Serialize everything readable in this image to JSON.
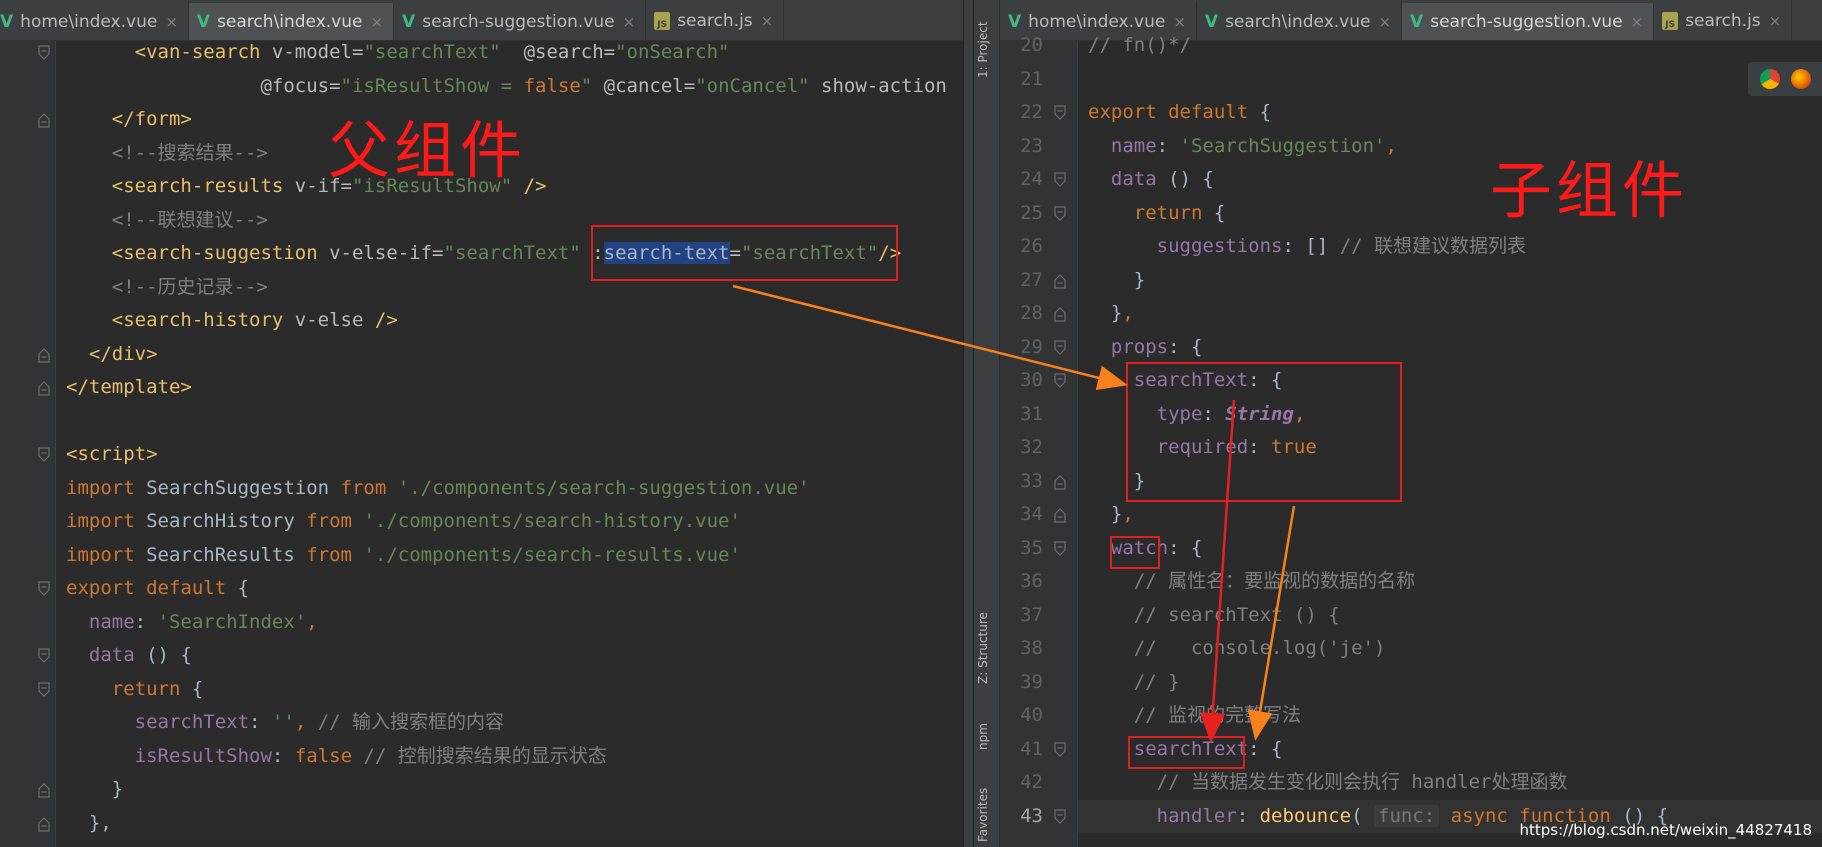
{
  "left": {
    "tabs": [
      {
        "label": "home\\index.vue",
        "icon": "vue-file-icon",
        "active": false
      },
      {
        "label": "search\\index.vue",
        "icon": "vue-file-icon",
        "active": true
      },
      {
        "label": "search-suggestion.vue",
        "icon": "vue-file-icon",
        "active": false
      },
      {
        "label": "search.js",
        "icon": "js-file-icon",
        "active": false
      }
    ],
    "annotation": "父组件",
    "lines": [
      [
        {
          "t": "      ",
          "c": "plain"
        },
        {
          "t": "<van-search ",
          "c": "tag"
        },
        {
          "t": "v-model=",
          "c": "attr"
        },
        {
          "t": "\"searchText\"",
          "c": "str"
        },
        {
          "t": "  @search=",
          "c": "attr"
        },
        {
          "t": "\"onSearch\"",
          "c": "str"
        }
      ],
      [
        {
          "t": "                 @focus=",
          "c": "attr"
        },
        {
          "t": "\"isResultShow = ",
          "c": "str"
        },
        {
          "t": "false",
          "c": "kw"
        },
        {
          "t": "\" ",
          "c": "str"
        },
        {
          "t": "@cancel=",
          "c": "attr"
        },
        {
          "t": "\"onCancel\"",
          "c": "str"
        },
        {
          "t": " show-action",
          "c": "attr"
        }
      ],
      [
        {
          "t": "    ",
          "c": "plain"
        },
        {
          "t": "</form>",
          "c": "tag"
        }
      ],
      [
        {
          "t": "    ",
          "c": "plain"
        },
        {
          "t": "<!--搜索结果-->",
          "c": "cmt"
        }
      ],
      [
        {
          "t": "    ",
          "c": "plain"
        },
        {
          "t": "<search-results ",
          "c": "tag"
        },
        {
          "t": "v-if=",
          "c": "attr"
        },
        {
          "t": "\"isResultShow\"",
          "c": "str"
        },
        {
          "t": " />",
          "c": "tag"
        }
      ],
      [
        {
          "t": "    ",
          "c": "plain"
        },
        {
          "t": "<!--联想建议-->",
          "c": "cmt"
        }
      ],
      [
        {
          "t": "    ",
          "c": "plain"
        },
        {
          "t": "<search-suggestion ",
          "c": "tag"
        },
        {
          "t": "v-else-if=",
          "c": "attr"
        },
        {
          "t": "\"searchText\"",
          "c": "str"
        },
        {
          "t": " :",
          "c": "attr"
        },
        {
          "t": "search-text",
          "c": "sel"
        },
        {
          "t": "=",
          "c": "attr"
        },
        {
          "t": "\"searchText\"",
          "c": "str"
        },
        {
          "t": "/>",
          "c": "tag"
        }
      ],
      [
        {
          "t": "    ",
          "c": "plain"
        },
        {
          "t": "<!--历史记录-->",
          "c": "cmt"
        }
      ],
      [
        {
          "t": "    ",
          "c": "plain"
        },
        {
          "t": "<search-history ",
          "c": "tag"
        },
        {
          "t": "v-else",
          "c": "attr"
        },
        {
          "t": " />",
          "c": "tag"
        }
      ],
      [
        {
          "t": "  ",
          "c": "plain"
        },
        {
          "t": "</div>",
          "c": "tag"
        }
      ],
      [
        {
          "t": "</template>",
          "c": "tag"
        }
      ],
      [],
      [
        {
          "t": "<script>",
          "c": "tag"
        }
      ],
      [
        {
          "t": "import ",
          "c": "kw"
        },
        {
          "t": "SearchSuggestion ",
          "c": "plain"
        },
        {
          "t": "from ",
          "c": "kw"
        },
        {
          "t": "'./components/search-suggestion.vue'",
          "c": "str"
        }
      ],
      [
        {
          "t": "import ",
          "c": "kw"
        },
        {
          "t": "SearchHistory ",
          "c": "plain"
        },
        {
          "t": "from ",
          "c": "kw"
        },
        {
          "t": "'./components/search-history.vue'",
          "c": "str"
        }
      ],
      [
        {
          "t": "import ",
          "c": "kw"
        },
        {
          "t": "SearchResults ",
          "c": "plain"
        },
        {
          "t": "from ",
          "c": "kw"
        },
        {
          "t": "'./components/search-results.vue'",
          "c": "str"
        }
      ],
      [
        {
          "t": "export default ",
          "c": "kw"
        },
        {
          "t": "{",
          "c": "plain"
        }
      ],
      [
        {
          "t": "  ",
          "c": "plain"
        },
        {
          "t": "name",
          "c": "prop"
        },
        {
          "t": ": ",
          "c": "plain"
        },
        {
          "t": "'SearchIndex'",
          "c": "str"
        },
        {
          "t": ",",
          "c": "kw"
        }
      ],
      [
        {
          "t": "  ",
          "c": "plain"
        },
        {
          "t": "data ",
          "c": "prop"
        },
        {
          "t": "() {",
          "c": "plain"
        }
      ],
      [
        {
          "t": "    ",
          "c": "plain"
        },
        {
          "t": "return ",
          "c": "kw"
        },
        {
          "t": "{",
          "c": "plain"
        }
      ],
      [
        {
          "t": "      ",
          "c": "plain"
        },
        {
          "t": "searchText",
          "c": "prop"
        },
        {
          "t": ": ",
          "c": "plain"
        },
        {
          "t": "''",
          "c": "str"
        },
        {
          "t": ", ",
          "c": "kw"
        },
        {
          "t": "// 输入搜索框的内容",
          "c": "cmt"
        }
      ],
      [
        {
          "t": "      ",
          "c": "plain"
        },
        {
          "t": "isResultShow",
          "c": "prop"
        },
        {
          "t": ": ",
          "c": "plain"
        },
        {
          "t": "false ",
          "c": "kw"
        },
        {
          "t": "// 控制搜索结果的显示状态",
          "c": "cmt"
        }
      ],
      [
        {
          "t": "    }",
          "c": "plain"
        }
      ],
      [
        {
          "t": "  },",
          "c": "plain"
        }
      ]
    ]
  },
  "right": {
    "sidebar": [
      "1: Project",
      "Z: Structure",
      "npm",
      "Favorites"
    ],
    "tabs": [
      {
        "label": "home\\index.vue",
        "icon": "vue-file-icon",
        "active": false
      },
      {
        "label": "search\\index.vue",
        "icon": "vue-file-icon",
        "active": false
      },
      {
        "label": "search-suggestion.vue",
        "icon": "vue-file-icon",
        "active": true
      },
      {
        "label": "search.js",
        "icon": "js-file-icon",
        "active": false
      }
    ],
    "annotation": "子组件",
    "line_numbers": [
      "20",
      "21",
      "22",
      "23",
      "24",
      "25",
      "26",
      "27",
      "28",
      "29",
      "30",
      "31",
      "32",
      "33",
      "34",
      "35",
      "36",
      "37",
      "38",
      "39",
      "40",
      "41",
      "42",
      "43"
    ],
    "current_line": "43",
    "lines": [
      [
        {
          "t": "// fn()*/",
          "c": "cmt"
        }
      ],
      [],
      [
        {
          "t": "export default ",
          "c": "kw"
        },
        {
          "t": "{",
          "c": "plain"
        }
      ],
      [
        {
          "t": "  ",
          "c": "plain"
        },
        {
          "t": "name",
          "c": "prop"
        },
        {
          "t": ": ",
          "c": "plain"
        },
        {
          "t": "'SearchSuggestion'",
          "c": "str"
        },
        {
          "t": ",",
          "c": "kw"
        }
      ],
      [
        {
          "t": "  ",
          "c": "plain"
        },
        {
          "t": "data ",
          "c": "prop"
        },
        {
          "t": "() {",
          "c": "plain"
        }
      ],
      [
        {
          "t": "    ",
          "c": "plain"
        },
        {
          "t": "return ",
          "c": "kw"
        },
        {
          "t": "{",
          "c": "plain"
        }
      ],
      [
        {
          "t": "      ",
          "c": "plain"
        },
        {
          "t": "suggestions",
          "c": "prop"
        },
        {
          "t": ": [] ",
          "c": "plain"
        },
        {
          "t": "// 联想建议数据列表",
          "c": "cmt"
        }
      ],
      [
        {
          "t": "    }",
          "c": "plain"
        }
      ],
      [
        {
          "t": "  }",
          "c": "plain"
        },
        {
          "t": ",",
          "c": "kw"
        }
      ],
      [
        {
          "t": "  ",
          "c": "plain"
        },
        {
          "t": "props",
          "c": "prop"
        },
        {
          "t": ": {",
          "c": "plain"
        }
      ],
      [
        {
          "t": "    ",
          "c": "plain"
        },
        {
          "t": "searchText",
          "c": "prop"
        },
        {
          "t": ": {",
          "c": "plain"
        }
      ],
      [
        {
          "t": "      ",
          "c": "plain"
        },
        {
          "t": "type",
          "c": "prop"
        },
        {
          "t": ": ",
          "c": "plain"
        },
        {
          "t": "String",
          "c": "type"
        },
        {
          "t": ",",
          "c": "kw"
        }
      ],
      [
        {
          "t": "      ",
          "c": "plain"
        },
        {
          "t": "required",
          "c": "prop"
        },
        {
          "t": ": ",
          "c": "plain"
        },
        {
          "t": "true",
          "c": "kw"
        }
      ],
      [
        {
          "t": "    }",
          "c": "plain"
        }
      ],
      [
        {
          "t": "  }",
          "c": "plain"
        },
        {
          "t": ",",
          "c": "kw"
        }
      ],
      [
        {
          "t": "  ",
          "c": "plain"
        },
        {
          "t": "watch",
          "c": "prop"
        },
        {
          "t": ": {",
          "c": "plain"
        }
      ],
      [
        {
          "t": "    ",
          "c": "plain"
        },
        {
          "t": "// 属性名：要监视的数据的名称",
          "c": "cmt"
        }
      ],
      [
        {
          "t": "    ",
          "c": "plain"
        },
        {
          "t": "// searchText () {",
          "c": "cmt"
        }
      ],
      [
        {
          "t": "    ",
          "c": "plain"
        },
        {
          "t": "//   console.log('je')",
          "c": "cmt"
        }
      ],
      [
        {
          "t": "    ",
          "c": "plain"
        },
        {
          "t": "// }",
          "c": "cmt"
        }
      ],
      [
        {
          "t": "    ",
          "c": "plain"
        },
        {
          "t": "// 监视的完整写法",
          "c": "cmt"
        }
      ],
      [
        {
          "t": "    ",
          "c": "plain"
        },
        {
          "t": "searchText",
          "c": "prop"
        },
        {
          "t": ": {",
          "c": "plain"
        }
      ],
      [
        {
          "t": "      ",
          "c": "plain"
        },
        {
          "t": "// 当数据发生变化则会执行 handler处理函数",
          "c": "cmt"
        }
      ],
      [
        {
          "t": "      ",
          "c": "plain"
        },
        {
          "t": "handler",
          "c": "prop"
        },
        {
          "t": ": ",
          "c": "plain"
        },
        {
          "t": "debounce",
          "c": "fn"
        },
        {
          "t": "( ",
          "c": "plain"
        },
        {
          "t": "func:",
          "c": "hint"
        },
        {
          "t": " async function ",
          "c": "kw"
        },
        {
          "t": "() {",
          "c": "plain"
        }
      ]
    ]
  },
  "watermark": "https://blog.csdn.net/weixin_44827418",
  "colors": {
    "annotation_red": "#ff1a1a",
    "arrow_orange": "#f7821b",
    "arrow_red": "#e82020",
    "tab_accent": "#4a88c7",
    "vue_green": "#41b883"
  }
}
